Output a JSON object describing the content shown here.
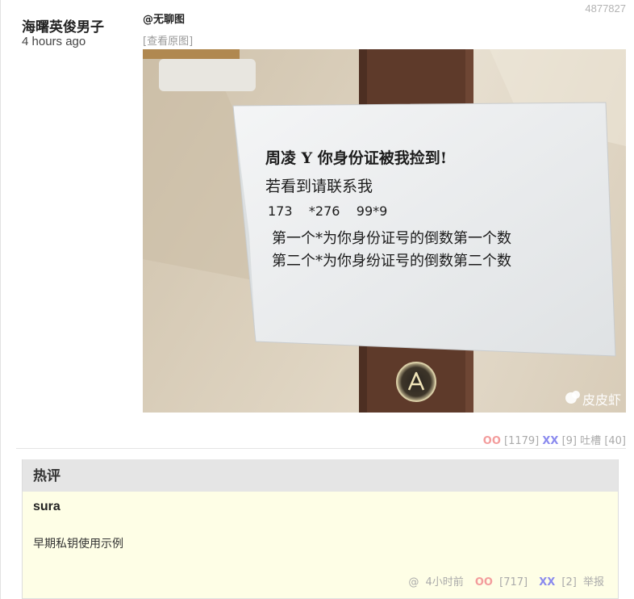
{
  "post": {
    "author": "海曙英俊男子",
    "time": "4 hours ago",
    "id": "4877827",
    "category": "@无聊图",
    "view_original": "[查看原图]"
  },
  "photo": {
    "note_lines": [
      "周凌 Y 你身份证被我捡到!",
      "若看到请联系我",
      "173    *276    99*9",
      "第一个*为你身份证号的倒数第一个数",
      "第二个*为你身纷证号的倒数第二个数"
    ],
    "watermark": "皮皮虾"
  },
  "votes": {
    "oo_label": "OO",
    "oo_count": "[1179]",
    "xx_label": "XX",
    "xx_count": "[9]",
    "tucao_label": "吐槽",
    "tucao_count": "[40]"
  },
  "hot_comments": {
    "title": "热评",
    "items": [
      {
        "author": "sura",
        "text": "早期私钥使用示例",
        "at": "@",
        "time": "4小时前",
        "oo_label": "OO",
        "oo_count": "[717]",
        "xx_label": "XX",
        "xx_count": "[2]",
        "report": "举报"
      }
    ]
  },
  "colors": {
    "oo": "#f39c9c",
    "xx": "#8a8aee",
    "comment_bg": "#fefee6",
    "header_bg": "#e5e5e5"
  }
}
